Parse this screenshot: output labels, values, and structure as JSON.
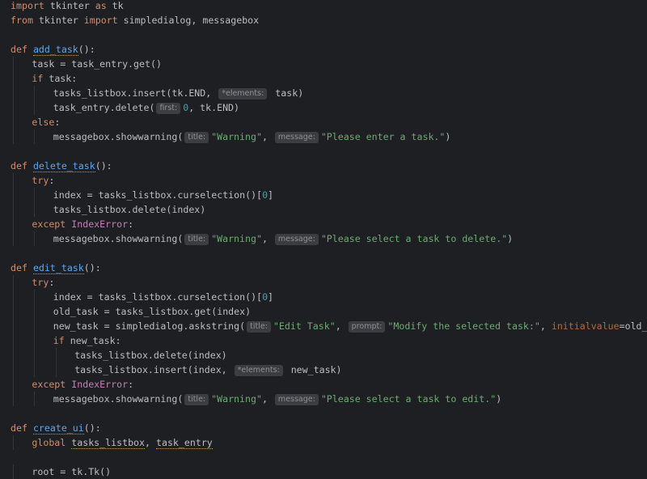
{
  "lines": [
    {
      "indent": 0,
      "tokens": [
        [
          "kw",
          "import"
        ],
        [
          "t",
          " tkinter "
        ],
        [
          "kw",
          "as"
        ],
        [
          "t",
          " tk"
        ]
      ]
    },
    {
      "indent": 0,
      "tokens": [
        [
          "kw",
          "from"
        ],
        [
          "t",
          " tkinter "
        ],
        [
          "kw",
          "import"
        ],
        [
          "t",
          " simpledialog, messagebox"
        ]
      ]
    },
    {
      "indent": 0,
      "tokens": []
    },
    {
      "indent": 0,
      "tokens": [
        [
          "kw",
          "def"
        ],
        [
          "t",
          " "
        ],
        [
          "fn",
          "add_task"
        ],
        [
          "t",
          "():"
        ]
      ]
    },
    {
      "indent": 1,
      "tokens": [
        [
          "t",
          "task = task_entry.get()"
        ]
      ]
    },
    {
      "indent": 1,
      "tokens": [
        [
          "kw",
          "if"
        ],
        [
          "t",
          " task:"
        ]
      ]
    },
    {
      "indent": 2,
      "tokens": [
        [
          "t",
          "tasks_listbox.insert(tk.END, "
        ],
        [
          "hint",
          "*elements:"
        ],
        [
          "t",
          " task)"
        ]
      ]
    },
    {
      "indent": 2,
      "tokens": [
        [
          "t",
          "task_entry.delete("
        ],
        [
          "hint",
          "first:"
        ],
        [
          "num",
          "0"
        ],
        [
          "t",
          ", tk.END)"
        ]
      ]
    },
    {
      "indent": 1,
      "tokens": [
        [
          "kw",
          "else"
        ],
        [
          "t",
          ":"
        ]
      ]
    },
    {
      "indent": 2,
      "tokens": [
        [
          "t",
          "messagebox.showwarning("
        ],
        [
          "hint",
          "title:"
        ],
        [
          "str",
          "\"Warning\""
        ],
        [
          "t",
          ", "
        ],
        [
          "hint",
          "message:"
        ],
        [
          "str",
          "\"Please enter a task.\""
        ],
        [
          "t",
          ")"
        ]
      ]
    },
    {
      "indent": 0,
      "tokens": []
    },
    {
      "indent": 0,
      "tokens": [
        [
          "kw",
          "def"
        ],
        [
          "t",
          " "
        ],
        [
          "fn",
          "delete_task"
        ],
        [
          "t",
          "():"
        ]
      ]
    },
    {
      "indent": 1,
      "tokens": [
        [
          "kw",
          "try"
        ],
        [
          "t",
          ":"
        ]
      ]
    },
    {
      "indent": 2,
      "tokens": [
        [
          "t",
          "index = tasks_listbox.curselection()["
        ],
        [
          "num",
          "0"
        ],
        [
          "t",
          "]"
        ]
      ]
    },
    {
      "indent": 2,
      "tokens": [
        [
          "t",
          "tasks_listbox.delete(index)"
        ]
      ]
    },
    {
      "indent": 1,
      "tokens": [
        [
          "kw",
          "except"
        ],
        [
          "t",
          " "
        ],
        [
          "cls",
          "IndexError"
        ],
        [
          "t",
          ":"
        ]
      ]
    },
    {
      "indent": 2,
      "tokens": [
        [
          "t",
          "messagebox.showwarning("
        ],
        [
          "hint",
          "title:"
        ],
        [
          "str",
          "\"Warning\""
        ],
        [
          "t",
          ", "
        ],
        [
          "hint",
          "message:"
        ],
        [
          "str",
          "\"Please select a task to delete.\""
        ],
        [
          "t",
          ")"
        ]
      ]
    },
    {
      "indent": 0,
      "tokens": []
    },
    {
      "indent": 0,
      "tokens": [
        [
          "kw",
          "def"
        ],
        [
          "t",
          " "
        ],
        [
          "fn",
          "edit_task"
        ],
        [
          "t",
          "():"
        ]
      ]
    },
    {
      "indent": 1,
      "tokens": [
        [
          "kw",
          "try"
        ],
        [
          "t",
          ":"
        ]
      ]
    },
    {
      "indent": 2,
      "tokens": [
        [
          "t",
          "index = tasks_listbox.curselection()["
        ],
        [
          "num",
          "0"
        ],
        [
          "t",
          "]"
        ]
      ]
    },
    {
      "indent": 2,
      "tokens": [
        [
          "t",
          "old_task = tasks_listbox.get(index)"
        ]
      ]
    },
    {
      "indent": 2,
      "tokens": [
        [
          "t",
          "new_task = simpledialog.askstring("
        ],
        [
          "hint",
          "title:"
        ],
        [
          "str",
          "\"Edit Task\""
        ],
        [
          "t",
          ", "
        ],
        [
          "hint",
          "prompt:"
        ],
        [
          "str",
          "\"Modify the selected task:\""
        ],
        [
          "t",
          ", "
        ],
        [
          "param",
          "initialvalue"
        ],
        [
          "t",
          "=old_task)"
        ]
      ]
    },
    {
      "indent": 2,
      "tokens": [
        [
          "kw",
          "if"
        ],
        [
          "t",
          " new_task:"
        ]
      ]
    },
    {
      "indent": 3,
      "tokens": [
        [
          "t",
          "tasks_listbox.delete(index)"
        ]
      ]
    },
    {
      "indent": 3,
      "tokens": [
        [
          "t",
          "tasks_listbox.insert(index, "
        ],
        [
          "hint",
          "*elements:"
        ],
        [
          "t",
          " new_task)"
        ]
      ]
    },
    {
      "indent": 1,
      "tokens": [
        [
          "kw",
          "except"
        ],
        [
          "t",
          " "
        ],
        [
          "cls",
          "IndexError"
        ],
        [
          "t",
          ":"
        ]
      ]
    },
    {
      "indent": 2,
      "tokens": [
        [
          "t",
          "messagebox.showwarning("
        ],
        [
          "hint",
          "title:"
        ],
        [
          "str",
          "\"Warning\""
        ],
        [
          "t",
          ", "
        ],
        [
          "hint",
          "message:"
        ],
        [
          "str",
          "\"Please select a task to edit.\""
        ],
        [
          "t",
          ")"
        ]
      ]
    },
    {
      "indent": 0,
      "tokens": []
    },
    {
      "indent": 0,
      "tokens": [
        [
          "kw",
          "def"
        ],
        [
          "t",
          " "
        ],
        [
          "fn",
          "create_ui"
        ],
        [
          "t",
          "():"
        ]
      ]
    },
    {
      "indent": 1,
      "tokens": [
        [
          "kw",
          "global"
        ],
        [
          "t",
          " "
        ],
        [
          "global",
          "tasks_listbox"
        ],
        [
          "t",
          ", "
        ],
        [
          "global",
          "task_entry"
        ]
      ]
    },
    {
      "indent": 0,
      "tokens": []
    },
    {
      "indent": 1,
      "tokens": [
        [
          "t",
          "root = tk.Tk()"
        ]
      ]
    }
  ],
  "colors": {
    "background": "#1e1f22",
    "keyword": "#cf8e6d",
    "function": "#56a8f5",
    "string": "#6aab73",
    "number": "#2aacb8",
    "class": "#c77dbb",
    "param": "#b8673a",
    "text": "#bcbec4"
  }
}
